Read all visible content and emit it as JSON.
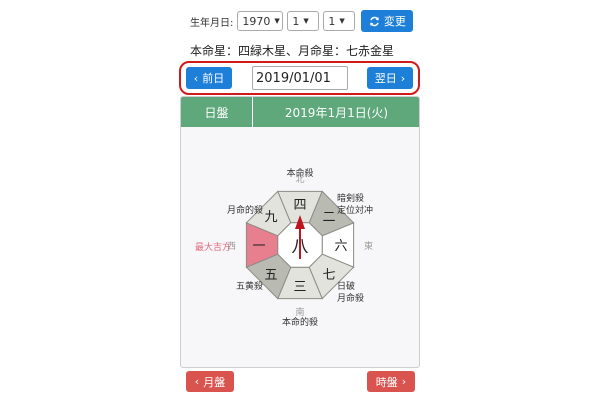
{
  "birth": {
    "label": "生年月日:",
    "year": "1970",
    "month": "1",
    "day": "1",
    "change_label": "変更"
  },
  "honmei_text": "本命星：四緑木星、月命星：七赤金星",
  "date_nav": {
    "prev_label": "前日",
    "date_value": "2019/01/01",
    "next_label": "翌日"
  },
  "panel": {
    "mode_label": "日盤",
    "date_label": "2019年1月1日(火)"
  },
  "board": {
    "center": "八",
    "cells": {
      "north": "四",
      "northeast": "二",
      "east": "六",
      "southeast": "七",
      "south": "三",
      "southwest": "五",
      "west": "一",
      "northwest": "九"
    },
    "directions": {
      "north": "北",
      "east": "東",
      "south": "南",
      "west": "西"
    },
    "annotations": {
      "north": "本命殺",
      "northeast_1": "暗剣殺",
      "northeast_2": "定位対冲",
      "northwest": "月命的殺",
      "west": "最大吉方",
      "southwest": "五黄殺",
      "southeast_1": "日破",
      "southeast_2": "月命殺",
      "south": "本命的殺"
    },
    "colors": {
      "light": "#e3e3dd",
      "dark": "#b9bbb3",
      "lucky": "#e77f8f",
      "arrow": "#c0151f",
      "lucky_text": "#e06b7e"
    }
  },
  "footer": {
    "month_label": "月盤",
    "hour_label": "時盤"
  }
}
